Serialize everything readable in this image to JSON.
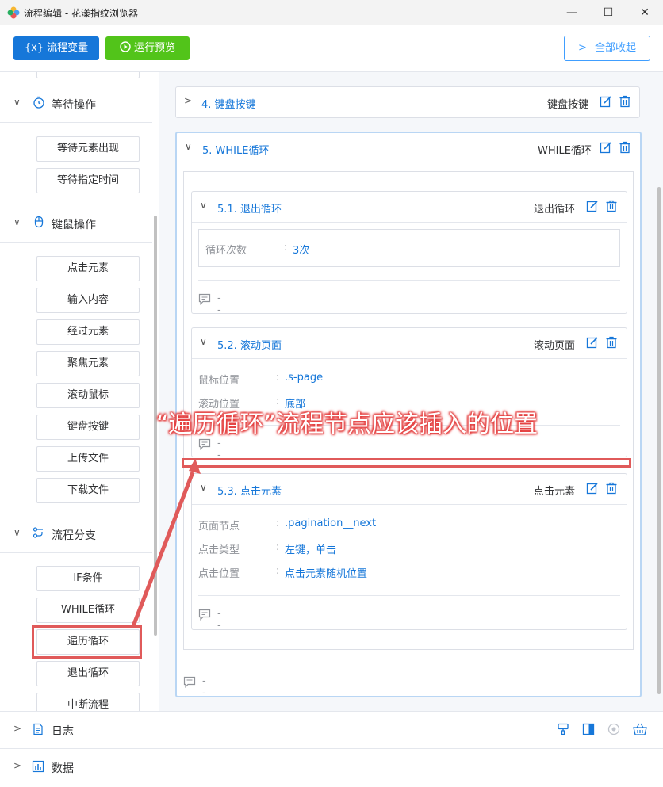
{
  "window": {
    "title": "流程编辑 - 花漾指纹浏览器",
    "controls": {
      "minimize": "—",
      "maximize": "☐",
      "close": "✕"
    }
  },
  "toolbar": {
    "vars_label": "流程变量",
    "vars_icon_text": "{x}",
    "run_label": "运行预览",
    "collapse_label": "全部收起"
  },
  "sidebar": {
    "groups": [
      {
        "label": "等待操作",
        "icon": "timer-icon",
        "items": [
          "等待元素出现",
          "等待指定时间"
        ]
      },
      {
        "label": "键鼠操作",
        "icon": "mouse-icon",
        "items": [
          "点击元素",
          "输入内容",
          "经过元素",
          "聚焦元素",
          "滚动鼠标",
          "键盘按键",
          "上传文件",
          "下载文件"
        ]
      },
      {
        "label": "流程分支",
        "icon": "branch-icon",
        "items": [
          "IF条件",
          "WHILE循环",
          "遍历循环",
          "退出循环",
          "中断流程"
        ]
      }
    ]
  },
  "main": {
    "card4": {
      "title": "4. 键盘按键",
      "type": "键盘按键"
    },
    "card5": {
      "title": "5. WHILE循环",
      "type": "WHILE循环",
      "comment": "--",
      "children": [
        {
          "title": "5.1. 退出循环",
          "type": "退出循环",
          "fields": [
            {
              "label": "循环次数",
              "value": "3次"
            }
          ],
          "comment": "--"
        },
        {
          "title": "5.2. 滚动页面",
          "type": "滚动页面",
          "fields": [
            {
              "label": "鼠标位置",
              "value": ".s-page"
            },
            {
              "label": "滚动位置",
              "value": "底部"
            }
          ],
          "comment": "--"
        },
        {
          "title": "5.3. 点击元素",
          "type": "点击元素",
          "fields": [
            {
              "label": "页面节点",
              "value": ".pagination__next"
            },
            {
              "label": "点击类型",
              "value": "左键，单击"
            },
            {
              "label": "点击位置",
              "value": "点击元素随机位置"
            }
          ],
          "comment": "--"
        }
      ]
    }
  },
  "bottom_panels": [
    {
      "label": "日志",
      "icon": "document-icon"
    },
    {
      "label": "数据",
      "icon": "bar-chart-icon"
    }
  ],
  "annotation": {
    "text": "“遍历循环”流程节点应该插入的位置"
  },
  "colors": {
    "primary": "#1677d9",
    "success": "#52c41a",
    "annotation": "#e05a5a"
  }
}
